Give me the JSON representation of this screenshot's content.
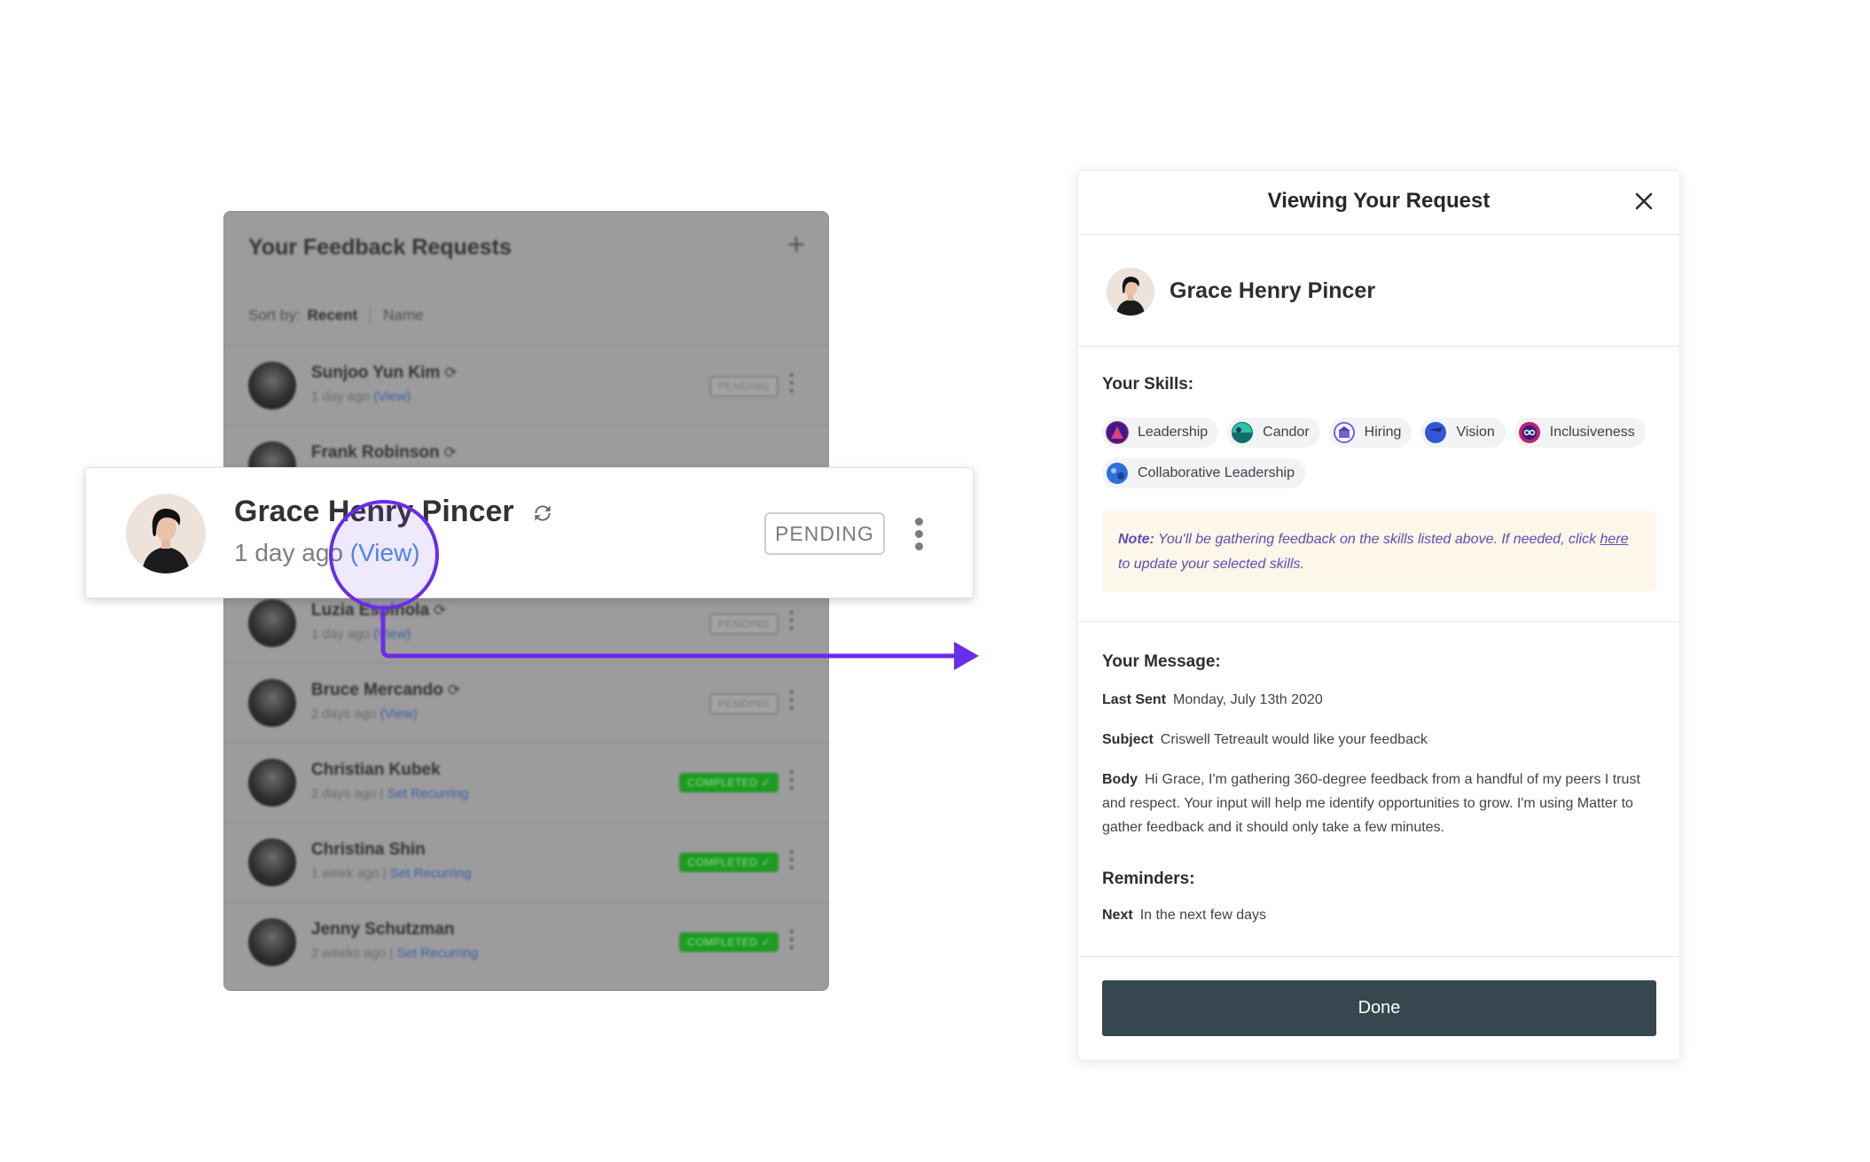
{
  "list": {
    "title": "Your Feedback Requests",
    "add_icon": "plus-icon",
    "sort_label": "Sort by:",
    "sort_recent": "Recent",
    "sort_name": "Name",
    "rows": [
      {
        "name": "Sunjoo Yun Kim",
        "meta": "1 day ago",
        "link": "(View)",
        "status": "PENDING"
      },
      {
        "name": "Frank Robinson",
        "meta": "",
        "link": "",
        "status": ""
      },
      {
        "name": "Luzia Espinola",
        "meta": "1 day ago",
        "link": "(View)",
        "status": "PENDING"
      },
      {
        "name": "Bruce Mercando",
        "meta": "2 days ago",
        "link": "(View)",
        "status": "PENDING"
      },
      {
        "name": "Christian Kubek",
        "meta": "2 days ago |",
        "link": "Set Recurring",
        "status": "COMPLETED"
      },
      {
        "name": "Christina Shin",
        "meta": "1 week ago |",
        "link": "Set Recurring",
        "status": "COMPLETED"
      },
      {
        "name": "Jenny Schutzman",
        "meta": "2 weeks ago |",
        "link": "Set Recurring",
        "status": "COMPLETED"
      }
    ]
  },
  "highlight": {
    "name": "Grace Henry Pincer",
    "meta": "1 day ago",
    "view_link": "(View)",
    "status": "PENDING"
  },
  "modal": {
    "title": "Viewing Your Request",
    "person_name": "Grace Henry Pincer",
    "skills_label": "Your Skills:",
    "skills": [
      {
        "label": "Leadership",
        "color": "#d6336c"
      },
      {
        "label": "Candor",
        "color": "#12a594"
      },
      {
        "label": "Hiring",
        "color": "#6d63d8"
      },
      {
        "label": "Vision",
        "color": "#3457d5"
      },
      {
        "label": "Inclusiveness",
        "color": "#7b2fbe"
      },
      {
        "label": "Collaborative Leadership",
        "color": "#2f6fd6"
      }
    ],
    "note_strong": "Note:",
    "note_text_1": " You'll be gathering feedback on the skills listed above. If needed, click ",
    "note_link": "here",
    "note_text_2": " to update your selected skills.",
    "message_label": "Your Message:",
    "last_sent_key": "Last Sent",
    "last_sent_value": "Monday, July 13th 2020",
    "subject_key": "Subject",
    "subject_value": "Criswell Tetreault would like your feedback",
    "body_key": "Body",
    "body_value": "Hi Grace, I'm gathering 360-degree feedback from a handful of my peers I trust and respect. Your input will help me identify opportunities to grow. I'm using Matter to gather feedback and it should only take a few minutes.",
    "reminders_label": "Reminders:",
    "next_key": "Next",
    "next_value": "In the next few days",
    "done_label": "Done"
  },
  "colors": {
    "accent_purple": "#6a2de8",
    "link_blue": "#4b8ce0",
    "done_button": "#37474f",
    "note_bg": "#fdf6ea",
    "completed_green": "#1f9a25"
  }
}
